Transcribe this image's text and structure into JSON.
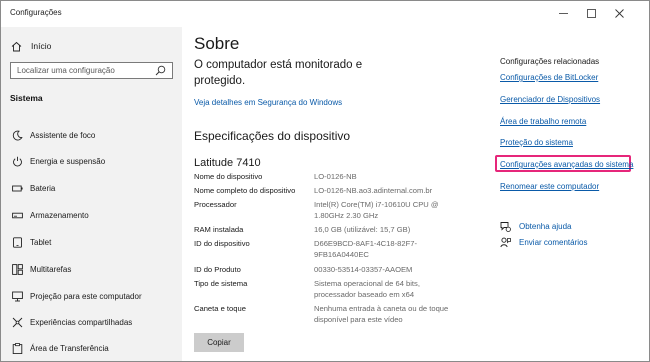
{
  "window": {
    "title": "Configurações",
    "minimize_symbol": "—",
    "maximize_symbol": "☐",
    "close_symbol": "✕"
  },
  "sidebar": {
    "home": {
      "label": "Início",
      "icon": "home-icon"
    },
    "search": {
      "placeholder": "Localizar uma configuração",
      "value": ""
    },
    "section_label": "Sistema",
    "items": [
      {
        "label": "Assistente de foco",
        "icon": "moon-icon"
      },
      {
        "label": "Energia e suspensão",
        "icon": "power-icon"
      },
      {
        "label": "Bateria",
        "icon": "battery-icon"
      },
      {
        "label": "Armazenamento",
        "icon": "storage-icon"
      },
      {
        "label": "Tablet",
        "icon": "tablet-icon"
      },
      {
        "label": "Multitarefas",
        "icon": "multitask-icon"
      },
      {
        "label": "Projeção para este computador",
        "icon": "projection-icon"
      },
      {
        "label": "Experiências compartilhadas",
        "icon": "shared-icon"
      },
      {
        "label": "Área de Transferência",
        "icon": "clipboard-icon"
      }
    ]
  },
  "main": {
    "title": "Sobre",
    "monitor_text": "O computador está monitorado e protegido.",
    "security_link": "Veja detalhes em Segurança do Windows",
    "specs_title": "Especificações do dispositivo",
    "device_name": "Latitude 7410",
    "specs": [
      {
        "key": "Nome do dispositivo",
        "value": "LO-0126-NB"
      },
      {
        "key": "Nome completo do dispositivo",
        "value": "LO-0126-NB.ao3.adinternal.com.br"
      },
      {
        "key": "Processador",
        "value": "Intel(R) Core(TM) i7-10610U CPU @ 1.80GHz   2.30 GHz"
      },
      {
        "key": "RAM instalada",
        "value": "16,0 GB (utilizável: 15,7 GB)"
      },
      {
        "key": "ID do dispositivo",
        "value": "D66E9BCD-8AF1-4C18-82F7-9FB16A0440EC"
      },
      {
        "key": "ID do Produto",
        "value": "00330-53514-03357-AAOEM"
      },
      {
        "key": "Tipo de sistema",
        "value": "Sistema operacional de 64 bits, processador baseado em x64"
      },
      {
        "key": "Caneta e toque",
        "value": "Nenhuma entrada à caneta ou de toque disponível para este vídeo"
      }
    ],
    "copy_button": "Copiar"
  },
  "related": {
    "title": "Configurações relacionadas",
    "links": [
      "Configurações de BitLocker",
      "Gerenciador de Dispositivos",
      "Área de trabalho remota",
      "Proteção do sistema",
      "Configurações avançadas do sistema",
      "Renomear este computador"
    ],
    "highlighted_link_index": 4,
    "highlight_color": "#e6267a",
    "help": [
      {
        "label": "Obtenha ajuda",
        "icon": "help-chat-icon"
      },
      {
        "label": "Enviar comentários",
        "icon": "feedback-icon"
      }
    ]
  },
  "colors": {
    "link": "#0a5aa8",
    "sidebar_bg": "#f2f2f2",
    "secondary_text": "#6a6a6a",
    "button_bg": "#cccccc"
  }
}
